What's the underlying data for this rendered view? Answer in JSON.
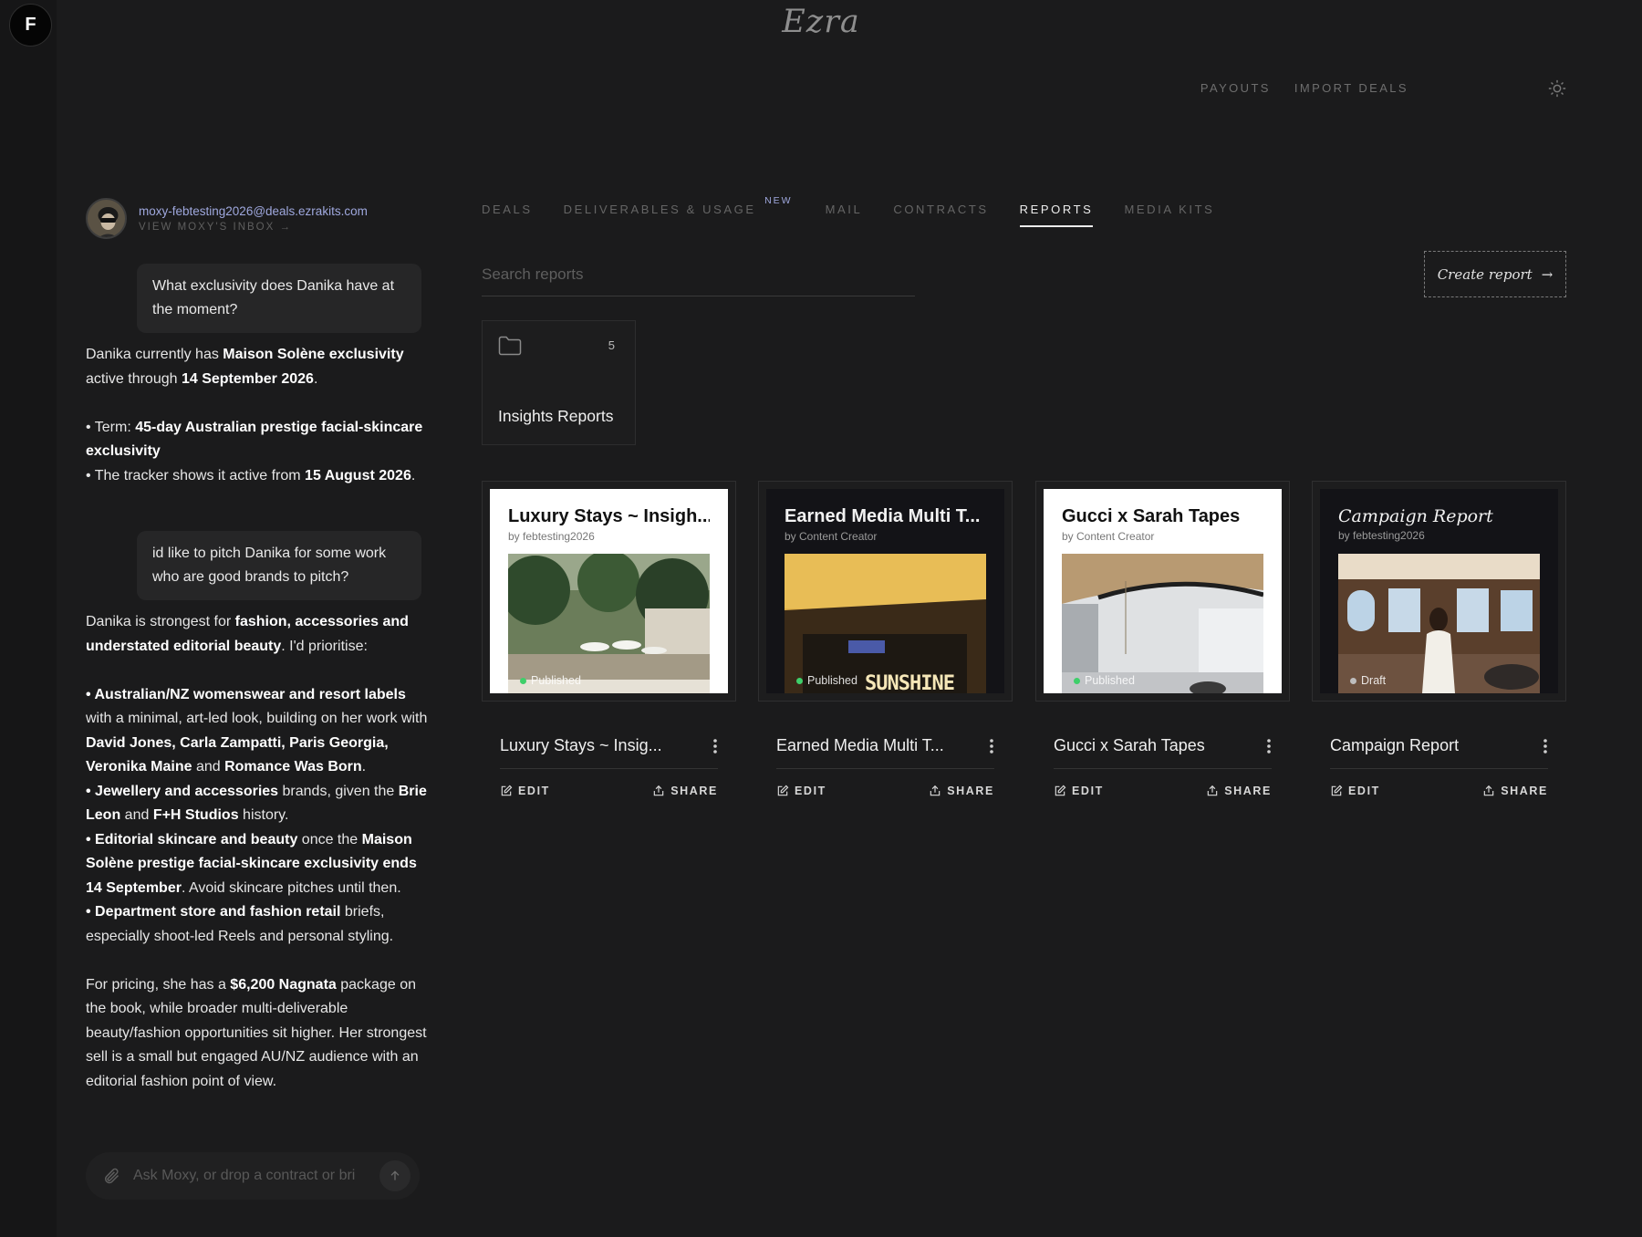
{
  "app": {
    "brand": "Ezra",
    "user_initial": "F",
    "top_links": [
      "PAYOUTS",
      "IMPORT DEALS"
    ]
  },
  "chat": {
    "email": "moxy-febtesting2026@deals.ezrakits.com",
    "inbox_link": "VIEW MOXY'S INBOX →",
    "q1": "What exclusivity does Danika have at the moment?",
    "a1": {
      "l1_a": "Danika currently has ",
      "l1_b": "Maison Solène exclusivity",
      "l1_c": " active through ",
      "l1_d": "14 September 2026",
      "l1_e": ".",
      "b1_a": "• Term: ",
      "b1_b": "45-day Australian prestige facial-skincare exclusivity",
      "b2_a": "• The tracker shows it active from ",
      "b2_b": "15 August 2026",
      "b2_c": "."
    },
    "q2": "id like to pitch Danika for some work who are good brands to pitch?",
    "a2": {
      "p1_a": "Danika is strongest for ",
      "p1_b": "fashion, accessories and understated editorial beauty",
      "p1_c": ". I'd prioritise:",
      "b1_a": "• Australian/NZ womenswear and resort labels",
      "b1_b": " with a minimal, art-led look, building on her work with ",
      "b1_c": "David Jones, Carla Zampatti, Paris Georgia, Veronika Maine",
      "b1_d": " and ",
      "b1_e": "Romance Was Born",
      "b1_f": ".",
      "b2_a": "• Jewellery and accessories",
      "b2_b": " brands, given the ",
      "b2_c": "Brie Leon",
      "b2_d": " and ",
      "b2_e": "F+H Studios",
      "b2_f": " history.",
      "b3_a": "• Editorial skincare and beauty",
      "b3_b": " once the ",
      "b3_c": "Maison Solène prestige facial-skincare exclusivity ends 14 September",
      "b3_d": ". Avoid skincare pitches until then.",
      "b4_a": "• Department store and fashion retail",
      "b4_b": " briefs, especially shoot-led Reels and personal styling.",
      "p2_a": "For pricing, she has a ",
      "p2_b": "$6,200 Nagnata",
      "p2_c": " package on the book, while broader multi-deliverable beauty/fashion opportunities sit higher. Her strongest sell is a small but engaged AU/NZ audience with an editorial fashion point of view."
    },
    "input_placeholder": "Ask Moxy, or drop a contract or bri"
  },
  "tabs": [
    {
      "label": "DEALS"
    },
    {
      "label": "DELIVERABLES & USAGE",
      "badge": "NEW"
    },
    {
      "label": "MAIL"
    },
    {
      "label": "CONTRACTS"
    },
    {
      "label": "REPORTS",
      "active": true
    },
    {
      "label": "MEDIA KITS"
    }
  ],
  "search": {
    "placeholder": "Search reports"
  },
  "create_button": "Create report",
  "folder": {
    "label": "Insights Reports",
    "count": "5"
  },
  "card_actions": {
    "edit": "EDIT",
    "share": "SHARE"
  },
  "cards": [
    {
      "thumb_title": "Luxury Stays ~ Insigh...",
      "by": "by febtesting2026",
      "status": "Published",
      "name": "Luxury Stays ~ Insig...",
      "theme": "light"
    },
    {
      "thumb_title": "Earned Media Multi T...",
      "by": "by Content Creator",
      "status": "Published",
      "name": "Earned Media Multi T...",
      "theme": "dark",
      "photo_text": "SUNSHINE"
    },
    {
      "thumb_title": "Gucci x Sarah Tapes",
      "by": "by Content Creator",
      "status": "Published",
      "name": "Gucci x Sarah Tapes",
      "theme": "light"
    },
    {
      "thumb_title": "Campaign Report",
      "by": "by febtesting2026",
      "status": "Draft",
      "name": "Campaign Report",
      "theme": "dark"
    }
  ],
  "colors": {
    "background": "#1b1b1c",
    "accent": "#9fa8de",
    "published": "#3ecf6a"
  }
}
